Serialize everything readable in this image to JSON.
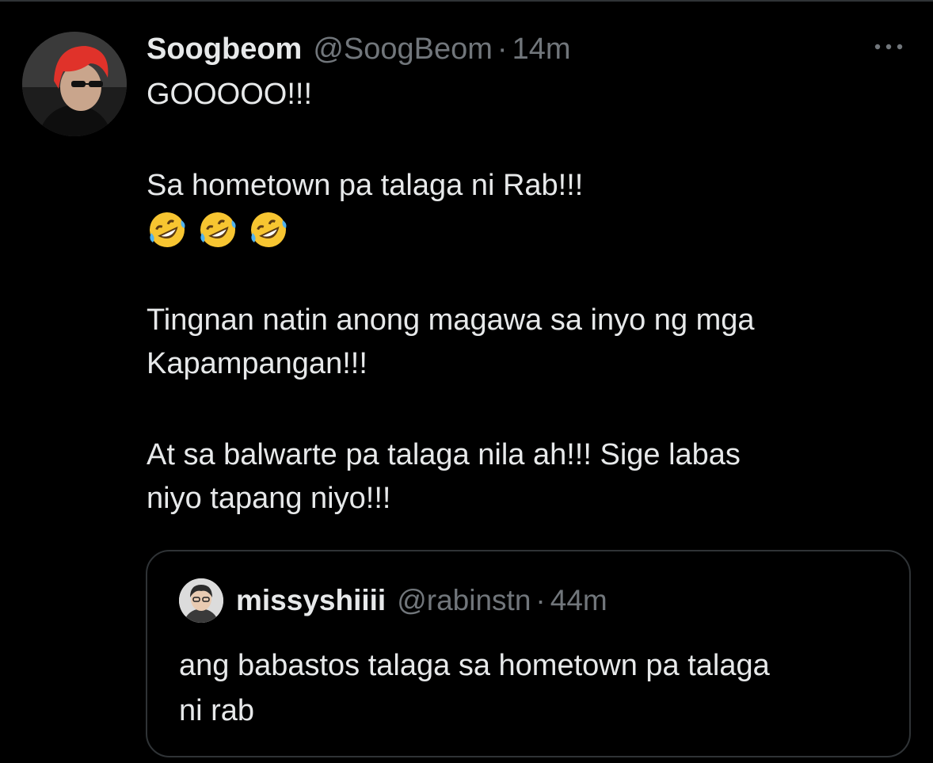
{
  "tweet": {
    "display_name": "Soogbeom",
    "handle": "@SoogBeom",
    "separator": "·",
    "time": "14m",
    "lines": {
      "l1": "GOOOOO!!!",
      "l2": "Sa hometown pa talaga ni Rab!!!",
      "l3": "Tingnan natin anong magawa sa inyo ng mga",
      "l4": "Kapampangan!!!",
      "l5": "At sa balwarte pa talaga nila ah!!! Sige labas",
      "l6": "niyo tapang niyo!!!"
    },
    "emojis": [
      "rolling-on-floor-laughing-emoji",
      "rolling-on-floor-laughing-emoji",
      "rolling-on-floor-laughing-emoji"
    ]
  },
  "quoted_tweet": {
    "display_name": "missyshiiii",
    "handle": "@rabinstn",
    "separator": "·",
    "time": "44m",
    "lines": {
      "l1": "ang babastos talaga sa hometown pa talaga",
      "l2": "ni rab"
    }
  },
  "icons": {
    "more": "more-horizontal-icon"
  },
  "colors": {
    "background": "#000000",
    "primary_text": "#e7e9ea",
    "secondary_text": "#71767b",
    "border": "#2f3336",
    "avatar_hair": "#e0322a"
  }
}
